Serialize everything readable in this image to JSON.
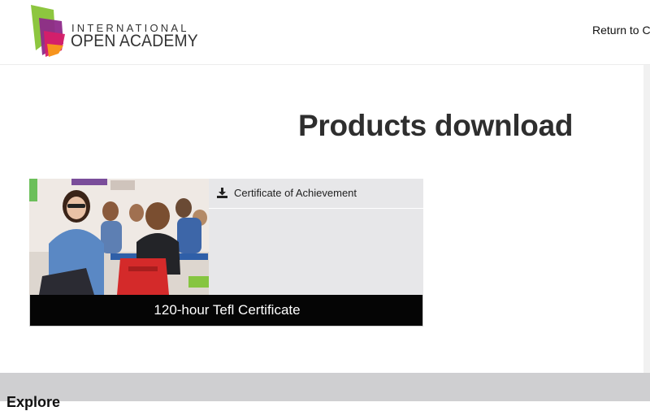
{
  "header": {
    "logo": {
      "line1": "INTERNATIONAL",
      "line2": "OPEN ACADEMY"
    },
    "return_link": "Return to Ca"
  },
  "main": {
    "title": "Products download",
    "product_card": {
      "image_icon": "classroom-photo",
      "downloads": [
        {
          "icon": "download-icon",
          "label": "Certificate of Achievement"
        }
      ],
      "title": "120-hour Tefl Certificate"
    }
  },
  "footer": {
    "heading": "Explore"
  },
  "colors": {
    "card_background": "#e7e7e9",
    "card_footer": "#050505",
    "footer_band": "#cfcfd1",
    "logo_green": "#8dc63f",
    "logo_purple": "#8e2a8a",
    "logo_magenta": "#d61f69",
    "logo_orange": "#f7941d"
  }
}
